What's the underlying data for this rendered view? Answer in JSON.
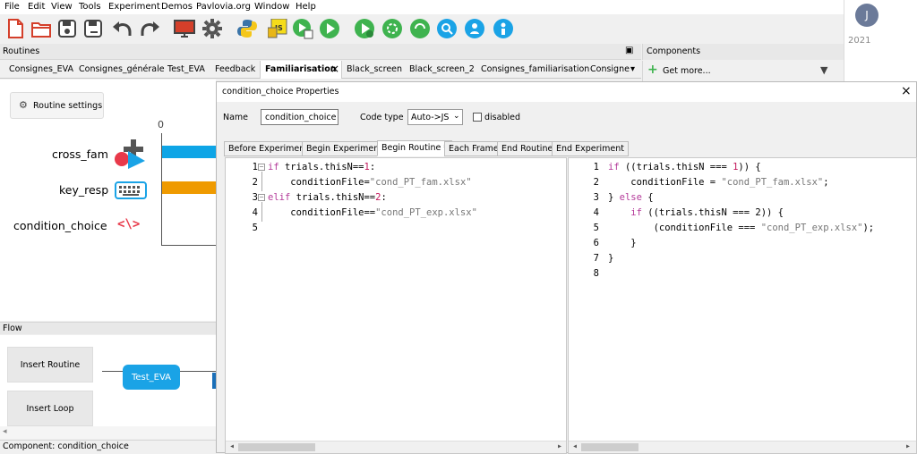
{
  "menu": [
    "File",
    "Edit",
    "View",
    "Tools",
    "Experiment",
    "Demos",
    "Pavlovia.org",
    "Window",
    "Help"
  ],
  "right_pane": {
    "avatar": "J",
    "year_text": "2021"
  },
  "routines_panel": {
    "title": "Routines",
    "collapse_glyph": "▣"
  },
  "routine_tabs": [
    "Consignes_EVA",
    "Consignes_générale",
    "Test_EVA",
    "Feedback",
    "Familiarisation",
    "Black_screen",
    "Black_screen_2",
    "Consignes_familiarisation",
    "Consignes"
  ],
  "active_routine_tab_close": "×",
  "tabs_more_glyph": "▾",
  "components_panel": {
    "title": "Components",
    "get_more": "Get more...",
    "plus": "+",
    "filter": "▼"
  },
  "routine_settings_label": "Routine settings",
  "timeline_zero": "0",
  "components": [
    {
      "label": "cross_fam",
      "bar_color": "#0ea5e6"
    },
    {
      "label": "key_resp",
      "bar_color": "#ef9a00"
    },
    {
      "label": "condition_choice",
      "icon_text": "<\\>"
    }
  ],
  "flow": {
    "title": "Flow",
    "insert_routine": "Insert Routine",
    "insert_loop": "Insert Loop",
    "routine_node": "Test_EVA"
  },
  "status": "Component: condition_choice",
  "dialog": {
    "title": "condition_choice Properties",
    "close": "×",
    "name_label": "Name",
    "name_value": "condition_choice",
    "code_type_label": "Code type",
    "code_type_value": "Auto->JS",
    "disabled_label": "disabled",
    "tabs": [
      "Before Experiment",
      "Begin Experiment",
      "Begin Routine *",
      "Each Frame",
      "End Routine",
      "End Experiment"
    ],
    "active_tab": 2
  },
  "python_code": [
    [
      "if",
      " trials.thisN==",
      "1",
      ":"
    ],
    [
      "",
      "    conditionFile=",
      "\"cond_PT_fam.xlsx\"",
      ""
    ],
    [
      "elif",
      " trials.thisN==",
      "2",
      ":"
    ],
    [
      "",
      "    conditionFile==",
      "\"cond_PT_exp.xlsx\"",
      ""
    ],
    [
      "",
      "",
      "",
      ""
    ]
  ],
  "js_code": [
    [
      "if",
      " ((trials.thisN === ",
      "1",
      ")) {"
    ],
    [
      "",
      "    conditionFile = ",
      "\"cond_PT_fam.xlsx\"",
      ";"
    ],
    [
      "",
      "} ",
      "else",
      " {"
    ],
    [
      "",
      "    ",
      "if",
      " ((trials.thisN === 2)) {"
    ],
    [
      "",
      "        (conditionFile === ",
      "\"cond_PT_exp.xlsx\"",
      ");"
    ],
    [
      "",
      "    }",
      "",
      ""
    ],
    [
      "",
      "}",
      "",
      ""
    ],
    [
      "",
      "",
      "",
      ""
    ]
  ]
}
